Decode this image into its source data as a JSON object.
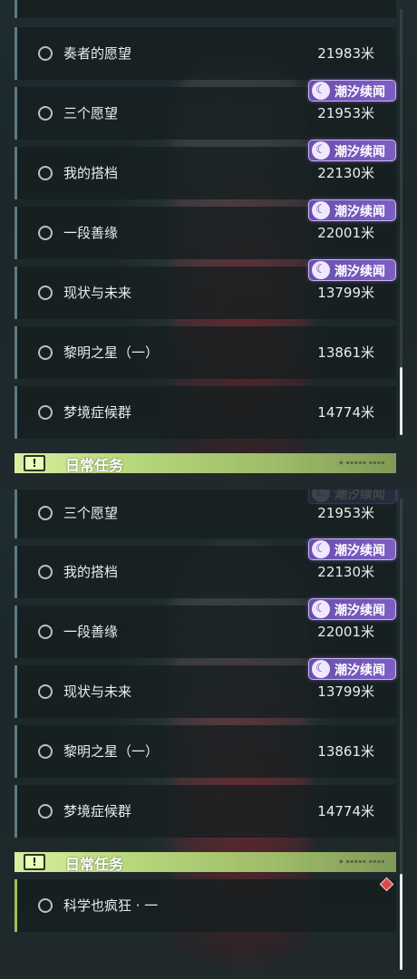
{
  "top": {
    "quests": [
      {
        "name": "奏者的愿望",
        "distance": "21983米",
        "badge": false
      },
      {
        "name": "三个愿望",
        "distance": "21953米",
        "badge": true
      },
      {
        "name": "我的搭档",
        "distance": "22130米",
        "badge": true
      },
      {
        "name": "一段善缘",
        "distance": "22001米",
        "badge": true
      },
      {
        "name": "现状与未来",
        "distance": "13799米",
        "badge": true
      },
      {
        "name": "黎明之星（一）",
        "distance": "13861米",
        "badge": false
      },
      {
        "name": "梦境症候群",
        "distance": "14774米",
        "badge": false
      }
    ],
    "section_title": "日常任务",
    "scroll_progress": 0.72
  },
  "bottom": {
    "quests": [
      {
        "name": "三个愿望",
        "distance": "21953米",
        "badge": true
      },
      {
        "name": "我的搭档",
        "distance": "22130米",
        "badge": true
      },
      {
        "name": "一段善缘",
        "distance": "22001米",
        "badge": true
      },
      {
        "name": "现状与未来",
        "distance": "13799米",
        "badge": true
      },
      {
        "name": "黎明之星（一）",
        "distance": "13861米",
        "badge": false
      },
      {
        "name": "梦境症候群",
        "distance": "14774米",
        "badge": false
      }
    ],
    "section_title": "日常任务",
    "daily_quest": {
      "name": "科学也疯狂 · 一"
    },
    "scroll_progress": 1.0
  },
  "badge_label": "潮汐续闻",
  "badge_icon": "tide-swirl-icon",
  "section_icon": "exclamation-icon",
  "colors": {
    "badge": "#7058b8",
    "section": "#c4e08a",
    "alert": "#d84a4a"
  }
}
